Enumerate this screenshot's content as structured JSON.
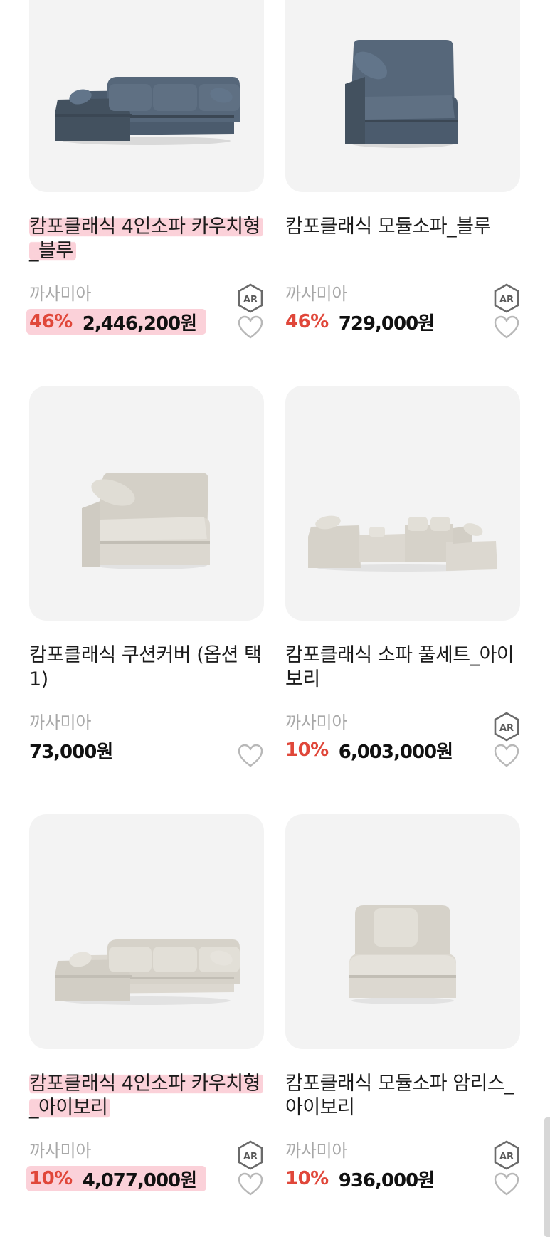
{
  "products": [
    {
      "name_lines": [
        "캄포클래식 4인소파 카우치형",
        "_블루"
      ],
      "brand": "까사미아",
      "discount": "46%",
      "price": "2,446,200원",
      "ar": "AR",
      "color": "#4b5b6d",
      "highlighted": true
    },
    {
      "name_lines": [
        "캄포클래식 모듈소파_블루",
        ""
      ],
      "brand": "까사미아",
      "discount": "46%",
      "price": "729,000원",
      "ar": "AR",
      "color": "#4b5b6d",
      "highlighted": false
    },
    {
      "name_lines": [
        "캄포클래식 쿠션커버 (옵션 택",
        "1)"
      ],
      "brand": "까사미아",
      "discount": "",
      "price": "73,000원",
      "ar": "",
      "color": "#dcd8d0",
      "highlighted": false
    },
    {
      "name_lines": [
        "캄포클래식 소파 풀세트_아이",
        "보리"
      ],
      "brand": "까사미아",
      "discount": "10%",
      "price": "6,003,000원",
      "ar": "AR",
      "color": "#dcd8d0",
      "highlighted": false
    },
    {
      "name_lines": [
        "캄포클래식 4인소파 카우치형",
        "_아이보리"
      ],
      "brand": "까사미아",
      "discount": "10%",
      "price": "4,077,000원",
      "ar": "AR",
      "color": "#dcd8d0",
      "highlighted": true
    },
    {
      "name_lines": [
        "캄포클래식 모듈소파 암리스_",
        "아이보리"
      ],
      "brand": "까사미아",
      "discount": "10%",
      "price": "936,000원",
      "ar": "AR",
      "color": "#dcd8d0",
      "highlighted": false
    }
  ],
  "colors": {
    "discount": "#e0473a",
    "highlight": "#fac2cc",
    "card_bg": "#f3f3f3",
    "brand_text": "#a8a8a8"
  },
  "icons": {
    "wishlist": "heart-outline-icon",
    "ar": "ar-hexagon-icon"
  }
}
